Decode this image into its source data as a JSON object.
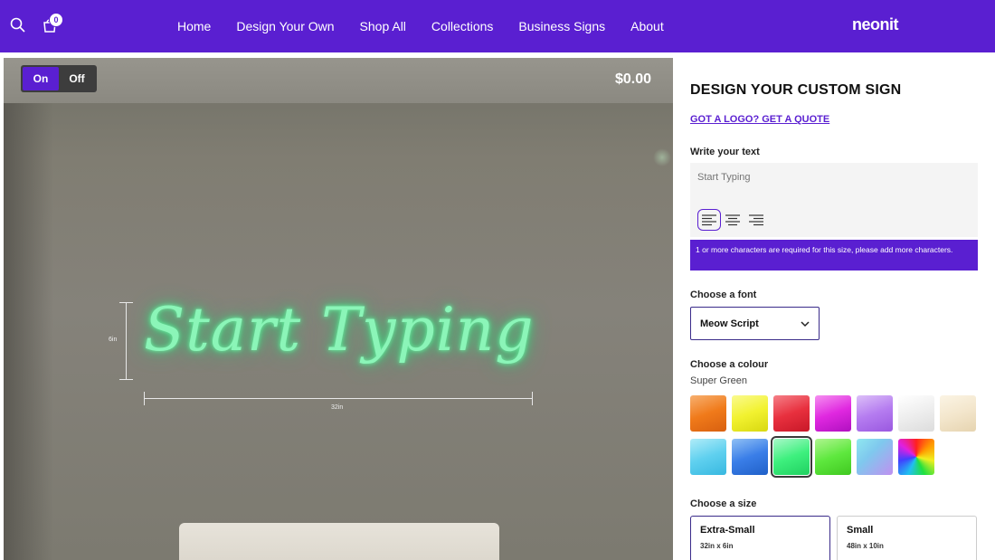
{
  "header": {
    "cart_count": "0",
    "nav": [
      "Home",
      "Design Your Own",
      "Shop All",
      "Collections",
      "Business Signs",
      "About"
    ],
    "logo": "neonit"
  },
  "preview": {
    "on_label": "On",
    "off_label": "Off",
    "price": "$0.00",
    "sign_text": "Start Typing",
    "height_label": "6in",
    "width_label": "32in"
  },
  "panel": {
    "title": "DESIGN YOUR CUSTOM SIGN",
    "logo_link": "GOT A LOGO? GET A QUOTE",
    "write_label": "Write your text",
    "text_placeholder": "Start Typing",
    "warning": "1 or more characters are required for this size, please add more characters.",
    "font_label": "Choose a font",
    "font_value": "Meow Script",
    "colour_label": "Choose a colour",
    "colour_value": "Super Green",
    "size_label": "Choose a size",
    "sizes": [
      {
        "name": "Extra-Small",
        "dims": "32in x 6in"
      },
      {
        "name": "Small",
        "dims": "48in x 10in"
      }
    ]
  },
  "colors": {
    "brand": "#5a1fd1",
    "swatches": [
      "#f07a1a",
      "#f2f230",
      "#e8303e",
      "#e028e0",
      "#b57cf0",
      "#eeeeee",
      "#f3e6cc",
      "#5fd0ef",
      "#3a7ee8",
      "#3ef07e",
      "#5ee83e",
      "#7fc8ee",
      "rainbow"
    ]
  }
}
